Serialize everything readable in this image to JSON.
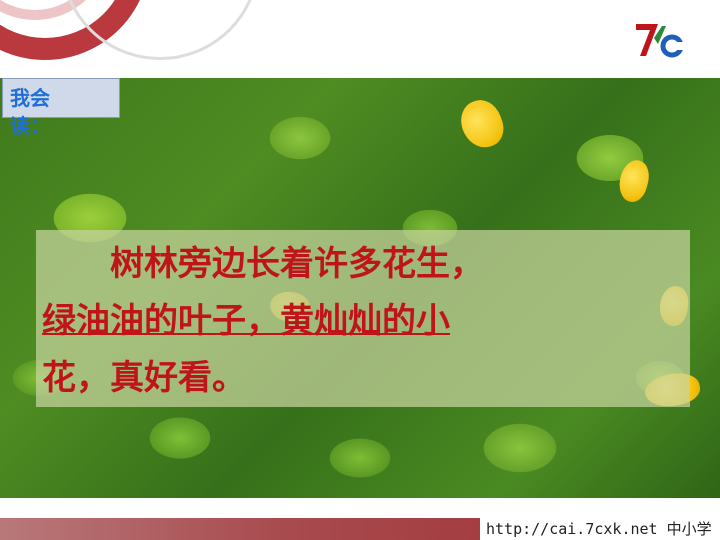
{
  "label": {
    "text": "我会读："
  },
  "passage": {
    "line1": "树林旁边长着许多花生，",
    "line2": "绿油油的叶子，黄灿灿的小",
    "line3": "花，真好看。"
  },
  "footer": {
    "url": "http://cai.7cxk.net 中小学"
  },
  "logo": {
    "icon": "7c-logo-icon"
  },
  "colors": {
    "text_red": "#c0141b",
    "label_blue": "#1e6fd6",
    "footer_red": "#9e2f33"
  }
}
